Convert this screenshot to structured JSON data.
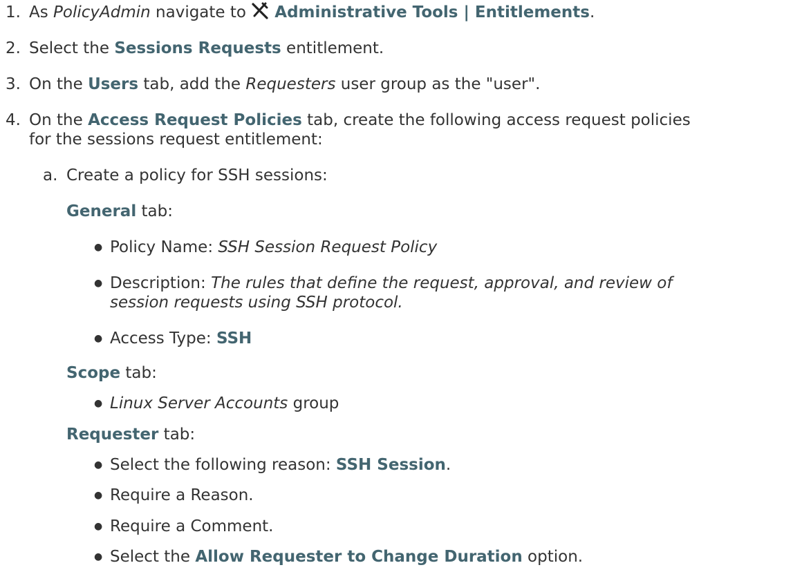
{
  "steps": {
    "s1": {
      "num": "1.",
      "t1": "As ",
      "t2": "PolicyAdmin",
      "t3": " navigate to ",
      "t4": "Administrative Tools | Entitlements",
      "t5": "."
    },
    "s2": {
      "num": "2.",
      "t1": "Select the ",
      "t2": "Sessions Requests",
      "t3": " entitlement."
    },
    "s3": {
      "num": "3.",
      "t1": "On the ",
      "t2": "Users",
      "t3": " tab, add the ",
      "t4": "Requesters",
      "t5": " user group as the \"user\"."
    },
    "s4": {
      "num": "4.",
      "t1": "On the ",
      "t2": "Access Request Policies",
      "t3": " tab, create the following access request policies",
      "t4": "for the sessions request entitlement:"
    }
  },
  "substep_a": {
    "letter": "a.",
    "text": "Create a policy for SSH sessions:"
  },
  "general_tab": {
    "heading": "General",
    "suffix": " tab:",
    "policy_name_label": "Policy Name: ",
    "policy_name_value": "SSH Session Request Policy",
    "description_label": "Description: ",
    "description_value_line1": "The rules that define the request, approval, and review of",
    "description_value_line2": "session requests using SSH protocol.",
    "access_type_label": "Access Type: ",
    "access_type_value": "SSH"
  },
  "scope_tab": {
    "heading": "Scope",
    "suffix": " tab:",
    "group_name": "Linux Server Accounts",
    "group_suffix": " group"
  },
  "requester_tab": {
    "heading": "Requester",
    "suffix": " tab:",
    "reason_prefix": "Select the following reason: ",
    "reason_value": "SSH Session",
    "reason_suffix": ".",
    "require_reason": "Require a Reason.",
    "require_comment": "Require a Comment.",
    "duration_prefix": "Select the ",
    "duration_option": "Allow Requester to Change Duration",
    "duration_suffix": " option."
  },
  "bullet_glyph": "●",
  "icons": {
    "admin_tools": "administrative-tools-icon"
  }
}
